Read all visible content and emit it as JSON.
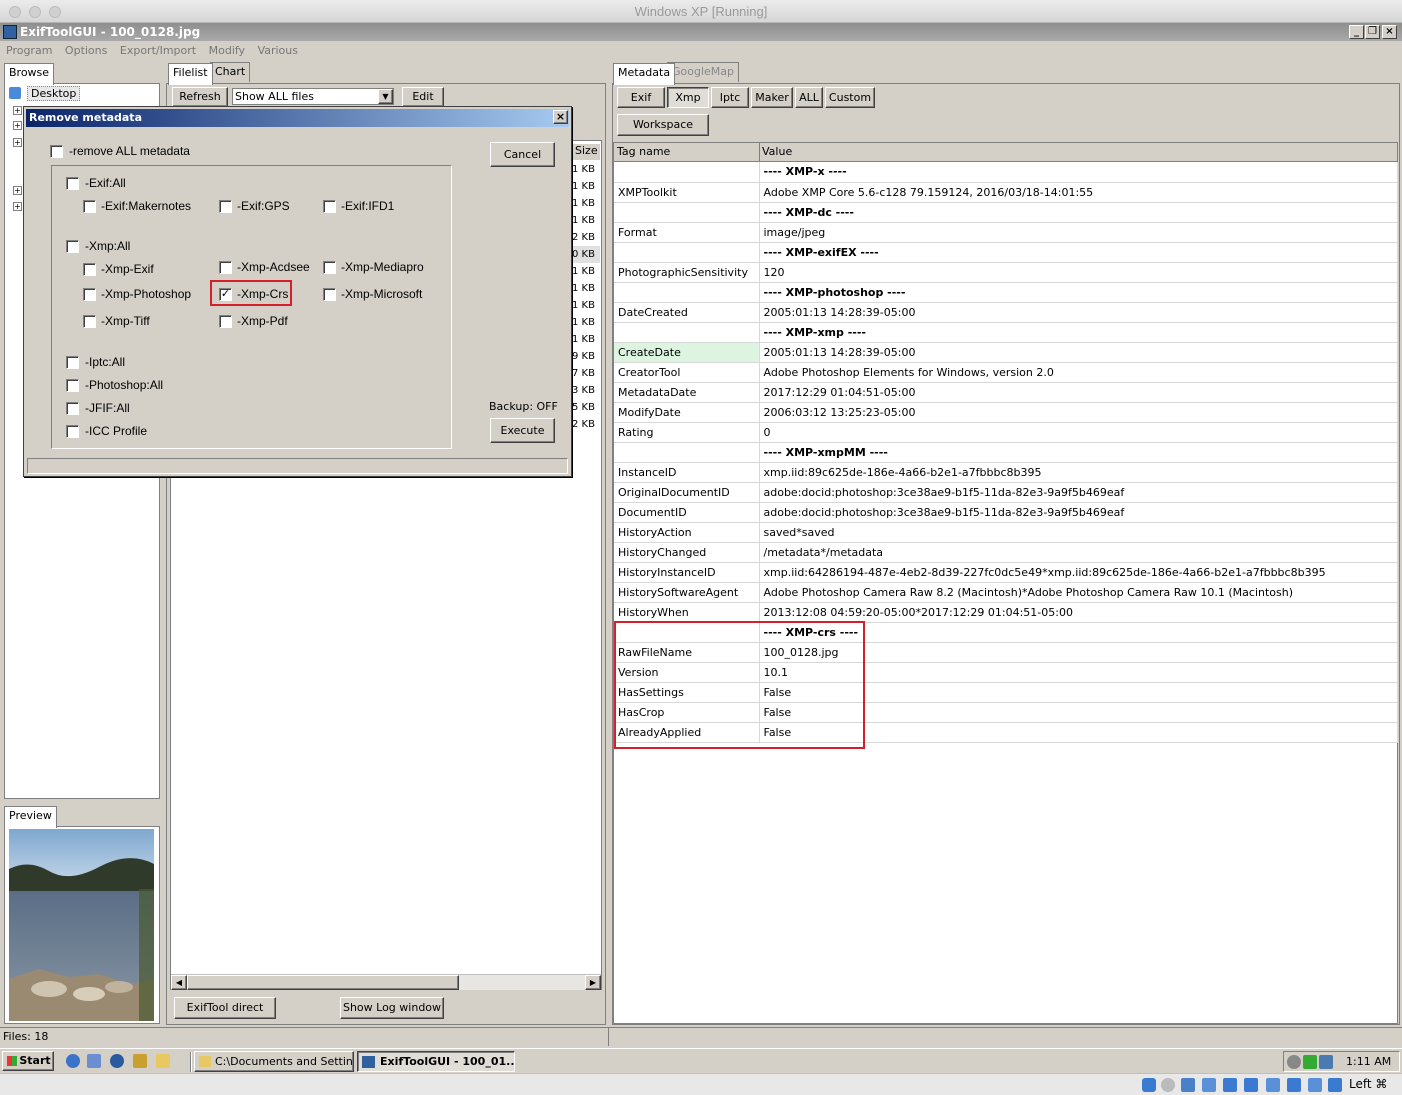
{
  "host": {
    "title": "Windows XP [Running]"
  },
  "app": {
    "title": "ExifToolGUI - 100_0128.jpg"
  },
  "menu": [
    "Program",
    "Options",
    "Export/Import",
    "Modify",
    "Various"
  ],
  "left": {
    "tab": "Browse",
    "tree_root": "Desktop",
    "preview_tab": "Preview",
    "status": "Files: 18"
  },
  "middle": {
    "tabs": [
      "Filelist",
      "Chart"
    ],
    "refresh": "Refresh",
    "filter_value": "Show ALL files",
    "edit": "Edit",
    "size_header": "Size",
    "sizes": [
      "1 KB",
      "1 KB",
      "1 KB",
      "1 KB",
      "2 KB",
      "0 KB",
      "1 KB",
      "1 KB",
      "1 KB",
      "1 KB",
      "1 KB",
      "9 KB",
      "7 KB",
      "3 KB",
      "5 KB",
      "2 KB"
    ],
    "exiftool_direct": "ExifTool direct",
    "show_log": "Show Log window"
  },
  "dialog": {
    "title": "Remove metadata",
    "remove_all": "-remove ALL metadata",
    "cancel": "Cancel",
    "backup": "Backup: OFF",
    "execute": "Execute",
    "items": {
      "exif_all": "-Exif:All",
      "exif_makernotes": "-Exif:Makernotes",
      "exif_gps": "-Exif:GPS",
      "exif_ifd1": "-Exif:IFD1",
      "xmp_all": "-Xmp:All",
      "xmp_exif": "-Xmp-Exif",
      "xmp_acdsee": "-Xmp-Acdsee",
      "xmp_mediapro": "-Xmp-Mediapro",
      "xmp_photoshop": "-Xmp-Photoshop",
      "xmp_crs": "-Xmp-Crs",
      "xmp_microsoft": "-Xmp-Microsoft",
      "xmp_tiff": "-Xmp-Tiff",
      "xmp_pdf": "-Xmp-Pdf",
      "iptc_all": "-Iptc:All",
      "photoshop_all": "-Photoshop:All",
      "jfif_all": "-JFIF:All",
      "icc_profile": "-ICC Profile"
    },
    "xmp_crs_checked": true
  },
  "right": {
    "tabs": [
      "Metadata",
      "GoogleMap"
    ],
    "buttons": [
      "Exif",
      "Xmp",
      "Iptc",
      "Maker",
      "ALL",
      "Custom"
    ],
    "workspace": "Workspace",
    "col_tag": "Tag name",
    "col_value": "Value",
    "rows": [
      {
        "tag": "",
        "value": "---- XMP-x ----",
        "section": true
      },
      {
        "tag": "XMPToolkit",
        "value": "Adobe XMP Core 5.6-c128 79.159124, 2016/03/18-14:01:55"
      },
      {
        "tag": "",
        "value": "---- XMP-dc ----",
        "section": true
      },
      {
        "tag": "Format",
        "value": "image/jpeg"
      },
      {
        "tag": "",
        "value": "---- XMP-exifEX ----",
        "section": true
      },
      {
        "tag": "PhotographicSensitivity",
        "value": "120"
      },
      {
        "tag": "",
        "value": "---- XMP-photoshop ----",
        "section": true
      },
      {
        "tag": "DateCreated",
        "value": "2005:01:13 14:28:39-05:00"
      },
      {
        "tag": "",
        "value": "---- XMP-xmp ----",
        "section": true
      },
      {
        "tag": "CreateDate",
        "value": "2005:01:13 14:28:39-05:00",
        "selected": true
      },
      {
        "tag": "CreatorTool",
        "value": "Adobe Photoshop Elements for Windows, version 2.0"
      },
      {
        "tag": "MetadataDate",
        "value": "2017:12:29 01:04:51-05:00"
      },
      {
        "tag": "ModifyDate",
        "value": "2006:03:12 13:25:23-05:00"
      },
      {
        "tag": "Rating",
        "value": "0"
      },
      {
        "tag": "",
        "value": "---- XMP-xmpMM ----",
        "section": true
      },
      {
        "tag": "InstanceID",
        "value": "xmp.iid:89c625de-186e-4a66-b2e1-a7fbbbc8b395"
      },
      {
        "tag": "OriginalDocumentID",
        "value": "adobe:docid:photoshop:3ce38ae9-b1f5-11da-82e3-9a9f5b469eaf"
      },
      {
        "tag": "DocumentID",
        "value": "adobe:docid:photoshop:3ce38ae9-b1f5-11da-82e3-9a9f5b469eaf"
      },
      {
        "tag": "HistoryAction",
        "value": "saved*saved"
      },
      {
        "tag": "HistoryChanged",
        "value": "/metadata*/metadata"
      },
      {
        "tag": "HistoryInstanceID",
        "value": "xmp.iid:64286194-487e-4eb2-8d39-227fc0dc5e49*xmp.iid:89c625de-186e-4a66-b2e1-a7fbbbc8b395"
      },
      {
        "tag": "HistorySoftwareAgent",
        "value": "Adobe Photoshop Camera Raw 8.2 (Macintosh)*Adobe Photoshop Camera Raw 10.1 (Macintosh)"
      },
      {
        "tag": "HistoryWhen",
        "value": "2013:12:08 04:59:20-05:00*2017:12:29 01:04:51-05:00"
      },
      {
        "tag": "",
        "value": "---- XMP-crs ----",
        "section": true
      },
      {
        "tag": "RawFileName",
        "value": "100_0128.jpg"
      },
      {
        "tag": "Version",
        "value": "10.1"
      },
      {
        "tag": "HasSettings",
        "value": "False"
      },
      {
        "tag": "HasCrop",
        "value": "False"
      },
      {
        "tag": "AlreadyApplied",
        "value": "False"
      }
    ]
  },
  "taskbar": {
    "start": "Start",
    "tasks": [
      "C:\\Documents and Settin...",
      "ExifToolGUI - 100_01..."
    ],
    "clock": "1:11 AM"
  },
  "host_status": {
    "keyboard": "Left ⌘"
  },
  "colors": {
    "title_active": "#0a246a",
    "selected_row": "#ddf5e0",
    "highlight_box": "#d51f2a"
  }
}
